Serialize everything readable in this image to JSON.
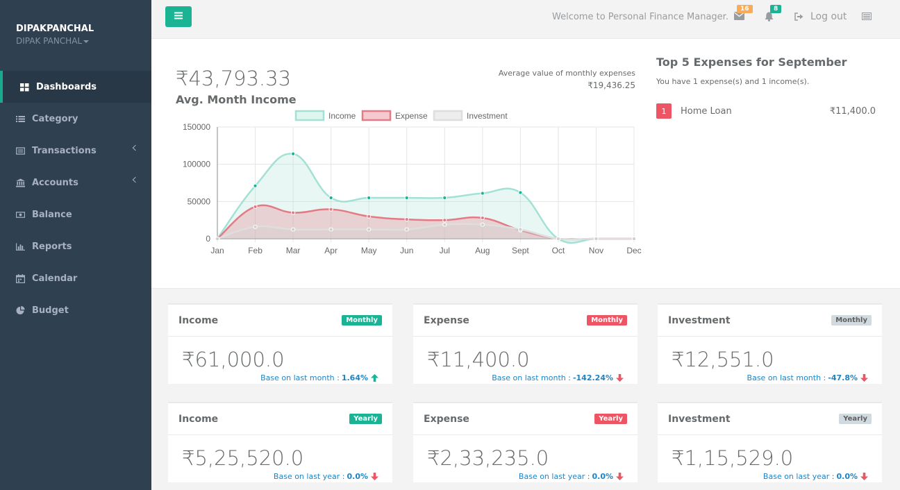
{
  "profile": {
    "username": "DIPAKPANCHAL",
    "display_name": "DIPAK PANCHAL"
  },
  "sidebar": {
    "items": [
      {
        "label": "Dashboards",
        "icon": "th-large-icon",
        "active": true
      },
      {
        "label": "Category",
        "icon": "list-icon"
      },
      {
        "label": "Transactions",
        "icon": "list-alt-icon",
        "has_arrow": true
      },
      {
        "label": "Accounts",
        "icon": "bank-icon",
        "has_arrow": true
      },
      {
        "label": "Balance",
        "icon": "money-icon"
      },
      {
        "label": "Reports",
        "icon": "bar-chart-icon"
      },
      {
        "label": "Calendar",
        "icon": "calendar-icon"
      },
      {
        "label": "Budget",
        "icon": "pie-chart-icon"
      }
    ]
  },
  "topbar": {
    "welcome": "Welcome to Personal Finance Manager.",
    "messages_count": "16",
    "notifications_count": "8",
    "logout_label": "Log out"
  },
  "summary": {
    "avg_income_value": "₹43,793.33",
    "avg_income_label": "Avg. Month Income",
    "avg_expense_label": "Average value of monthly expenses",
    "avg_expense_value": "₹19,436.25"
  },
  "top5": {
    "title": "Top 5 Expenses for September",
    "subtitle": "You have 1 expense(s) and 1 income(s).",
    "items": [
      {
        "rank": "1",
        "name": "Home Loan",
        "amount": "₹11,400.0"
      }
    ]
  },
  "chart_data": {
    "type": "area",
    "categories": [
      "Jan",
      "Feb",
      "Mar",
      "Apr",
      "May",
      "Jun",
      "Jul",
      "Aug",
      "Sept",
      "Oct",
      "Nov",
      "Dec"
    ],
    "ylim": [
      0,
      150000
    ],
    "yticks": [
      0,
      50000,
      100000,
      150000
    ],
    "ytick_labels": [
      "0",
      "50000",
      "100000",
      "150000"
    ],
    "grid": true,
    "legend_position": "top",
    "series": [
      {
        "name": "Income",
        "values": [
          0,
          71000,
          114000,
          55000,
          55000,
          55000,
          55000,
          61000,
          62000,
          0,
          0,
          0
        ],
        "color": "#a3e1d4"
      },
      {
        "name": "Expense",
        "values": [
          0,
          43000,
          35000,
          39500,
          30000,
          26000,
          25000,
          28000,
          11400,
          0,
          0,
          0
        ],
        "color": "#e47a85"
      },
      {
        "name": "Investment",
        "values": [
          0,
          16000,
          12500,
          12500,
          12500,
          12500,
          19000,
          19000,
          12551,
          0,
          0,
          0
        ],
        "color": "#dedede"
      }
    ]
  },
  "cards": [
    {
      "title": "Income",
      "period": "Monthly",
      "value": "₹61,000.0",
      "base_text": "Base on last month :",
      "pct": "1.64%",
      "trend": "up",
      "label_color": "green"
    },
    {
      "title": "Expense",
      "period": "Monthly",
      "value": "₹11,400.0",
      "base_text": "Base on last month :",
      "pct": "-142.24%",
      "trend": "down",
      "label_color": "red"
    },
    {
      "title": "Investment",
      "period": "Monthly",
      "value": "₹12,551.0",
      "base_text": "Base on last month :",
      "pct": "-47.8%",
      "trend": "down",
      "label_color": "gray"
    },
    {
      "title": "Income",
      "period": "Yearly",
      "value": "₹5,25,520.0",
      "base_text": "Base on last year :",
      "pct": "0.0%",
      "trend": "down",
      "label_color": "green"
    },
    {
      "title": "Expense",
      "period": "Yearly",
      "value": "₹2,33,235.0",
      "base_text": "Base on last year :",
      "pct": "0.0%",
      "trend": "down",
      "label_color": "red"
    },
    {
      "title": "Investment",
      "period": "Yearly",
      "value": "₹1,15,529.0",
      "base_text": "Base on last year :",
      "pct": "0.0%",
      "trend": "down",
      "label_color": "gray"
    }
  ]
}
